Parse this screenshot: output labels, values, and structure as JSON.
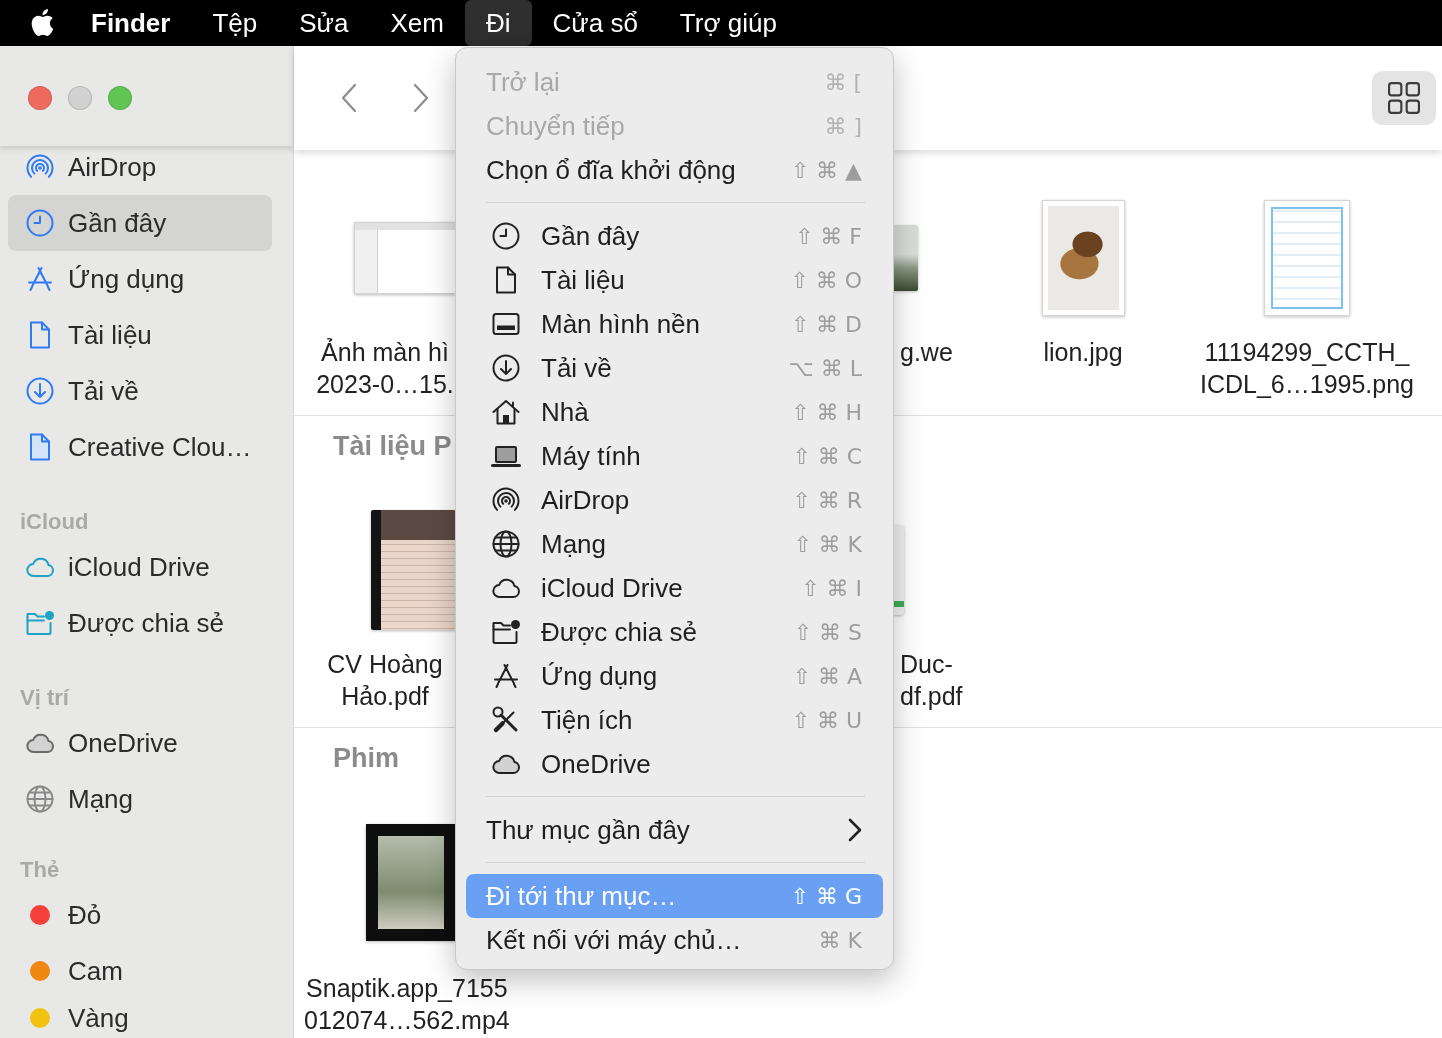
{
  "menu_bar": {
    "items": [
      {
        "label": "Finder",
        "kind": "app",
        "selected": false
      },
      {
        "label": "Tệp",
        "kind": "menu",
        "selected": false
      },
      {
        "label": "Sửa",
        "kind": "menu",
        "selected": false
      },
      {
        "label": "Xem",
        "kind": "menu",
        "selected": false
      },
      {
        "label": "Đi",
        "kind": "menu",
        "selected": true
      },
      {
        "label": "Cửa sổ",
        "kind": "menu",
        "selected": false
      },
      {
        "label": "Trợ giúp",
        "kind": "menu",
        "selected": false
      }
    ]
  },
  "window": {
    "controls": [
      {
        "kind": "close",
        "disabled": false
      },
      {
        "kind": "minimize",
        "disabled": true
      },
      {
        "kind": "zoom",
        "disabled": false
      }
    ]
  },
  "sidebar": {
    "sections": [
      {
        "items": [
          {
            "label": "AirDrop",
            "selected": false
          },
          {
            "label": "Gần đây",
            "selected": true
          },
          {
            "label": "Ứng dụng",
            "selected": false
          },
          {
            "label": "Tài liệu",
            "selected": false
          },
          {
            "label": "Tải về",
            "selected": false
          },
          {
            "label": "Creative Clou…",
            "selected": false
          }
        ]
      },
      {
        "title": "iCloud",
        "items": [
          {
            "label": "iCloud Drive",
            "selected": false
          },
          {
            "label": "Được chia sẻ",
            "selected": false
          }
        ]
      },
      {
        "title": "Vị trí",
        "items": [
          {
            "label": "OneDrive",
            "selected": false
          },
          {
            "label": "Mạng",
            "selected": false
          }
        ]
      },
      {
        "title": "Thẻ",
        "items": [
          {
            "label": "Đỏ",
            "color": "#f5413a",
            "selected": false
          },
          {
            "label": "Cam",
            "color": "#ef8711",
            "selected": false
          },
          {
            "label": "Vàng",
            "color": "#f1c20f",
            "selected": false
          }
        ]
      }
    ]
  },
  "content": {
    "groups": [
      {
        "files": [
          {
            "kind": "screenshot",
            "lines": [
              "Ảnh màn hì",
              "2023-0…15."
            ]
          },
          {
            "kind": "photo",
            "lines": [
              "g.we"
            ]
          },
          {
            "kind": "photo",
            "lines": [
              "lion.jpg"
            ]
          },
          {
            "kind": "certificate",
            "lines": [
              "11194299_CCTH_",
              "ICDL_6…1995.png"
            ]
          }
        ]
      },
      {
        "title": "Tài liệu P",
        "files": [
          {
            "kind": "pdf",
            "lines": [
              "CV Hoàng",
              "Hảo.pdf"
            ]
          },
          {
            "kind": "pdf",
            "lines": [
              "Duc-",
              "df.pdf"
            ]
          }
        ]
      },
      {
        "title": "Phim",
        "files": [
          {
            "kind": "video",
            "lines": [
              "Snaptik.app_7155",
              "012074…562.mp4"
            ]
          }
        ]
      }
    ]
  },
  "go_menu": {
    "items": [
      {
        "kind": "item",
        "label": "Trở lại",
        "shortcut": "⌘ [",
        "disabled": true,
        "selected": false
      },
      {
        "kind": "item",
        "label": "Chuyển tiếp",
        "shortcut": "⌘ ]",
        "disabled": true,
        "selected": false
      },
      {
        "kind": "item",
        "label": "Chọn ổ đĩa khởi động",
        "shortcut": "⇧ ⌘ ▲",
        "disabled": false,
        "selected": false
      },
      {
        "kind": "separator"
      },
      {
        "kind": "place",
        "label": "Gần đây",
        "shortcut": "⇧ ⌘ F",
        "disabled": false,
        "selected": false
      },
      {
        "kind": "place",
        "label": "Tài liệu",
        "shortcut": "⇧ ⌘ O",
        "disabled": false,
        "selected": false
      },
      {
        "kind": "place",
        "label": "Màn hình nền",
        "shortcut": "⇧ ⌘ D",
        "disabled": false,
        "selected": false
      },
      {
        "kind": "place",
        "label": "Tải về",
        "shortcut": "⌥ ⌘ L",
        "disabled": false,
        "selected": false
      },
      {
        "kind": "place",
        "label": "Nhà",
        "shortcut": "⇧ ⌘ H",
        "disabled": false,
        "selected": false
      },
      {
        "kind": "place",
        "label": "Máy tính",
        "shortcut": "⇧ ⌘ C",
        "disabled": false,
        "selected": false
      },
      {
        "kind": "place",
        "label": "AirDrop",
        "shortcut": "⇧ ⌘ R",
        "disabled": false,
        "selected": false
      },
      {
        "kind": "place",
        "label": "Mạng",
        "shortcut": "⇧ ⌘ K",
        "disabled": false,
        "selected": false
      },
      {
        "kind": "place",
        "label": "iCloud Drive",
        "shortcut": "⇧ ⌘ I",
        "disabled": false,
        "selected": false
      },
      {
        "kind": "place",
        "label": "Được chia sẻ",
        "shortcut": "⇧ ⌘ S",
        "disabled": false,
        "selected": false
      },
      {
        "kind": "place",
        "label": "Ứng dụng",
        "shortcut": "⇧ ⌘ A",
        "disabled": false,
        "selected": false
      },
      {
        "kind": "place",
        "label": "Tiện ích",
        "shortcut": "⇧ ⌘ U",
        "disabled": false,
        "selected": false
      },
      {
        "kind": "place",
        "label": "OneDrive",
        "disabled": false,
        "selected": false
      },
      {
        "kind": "separator"
      },
      {
        "kind": "submenu",
        "label": "Thư mục gần đây",
        "disabled": false,
        "selected": false
      },
      {
        "kind": "separator"
      },
      {
        "kind": "item",
        "label": "Đi tới thư mục…",
        "shortcut": "⇧ ⌘ G",
        "disabled": false,
        "selected": true
      },
      {
        "kind": "item",
        "label": "Kết nối với máy chủ…",
        "shortcut": "⌘ K",
        "disabled": false,
        "selected": false
      }
    ]
  }
}
